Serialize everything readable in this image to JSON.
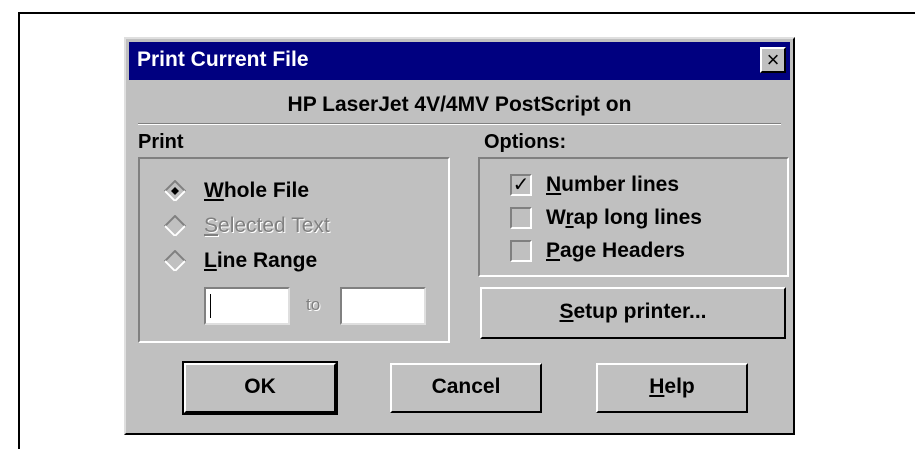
{
  "dialog": {
    "title": "Print Current File",
    "close_glyph": "×",
    "printer_name": "HP LaserJet 4V/4MV PostScript on"
  },
  "print_group": {
    "label": "Print",
    "options": [
      {
        "mnemonic": "W",
        "rest": "hole File",
        "selected": true,
        "enabled": true
      },
      {
        "mnemonic": "S",
        "rest": "elected Text",
        "selected": false,
        "enabled": false
      },
      {
        "mnemonic": "L",
        "rest": "ine Range",
        "selected": false,
        "enabled": true
      }
    ],
    "range_from": "",
    "to_label": "to",
    "range_to": ""
  },
  "options_group": {
    "label": "Options:",
    "items": [
      {
        "before": "",
        "mnemonic": "N",
        "after": "umber lines",
        "checked": true,
        "check_glyph": "✓"
      },
      {
        "before": "W",
        "mnemonic": "r",
        "after": "ap long lines",
        "checked": false,
        "check_glyph": ""
      },
      {
        "before": "",
        "mnemonic": "P",
        "after": "age Headers",
        "checked": false,
        "check_glyph": ""
      }
    ]
  },
  "buttons": {
    "setup": {
      "mnemonic": "S",
      "rest": "etup printer..."
    },
    "ok": "OK",
    "cancel": "Cancel",
    "help": {
      "mnemonic": "H",
      "rest": "elp"
    }
  },
  "colors": {
    "titlebar": "#000080",
    "face": "#c0c0c0",
    "disabled_text": "#808080"
  }
}
